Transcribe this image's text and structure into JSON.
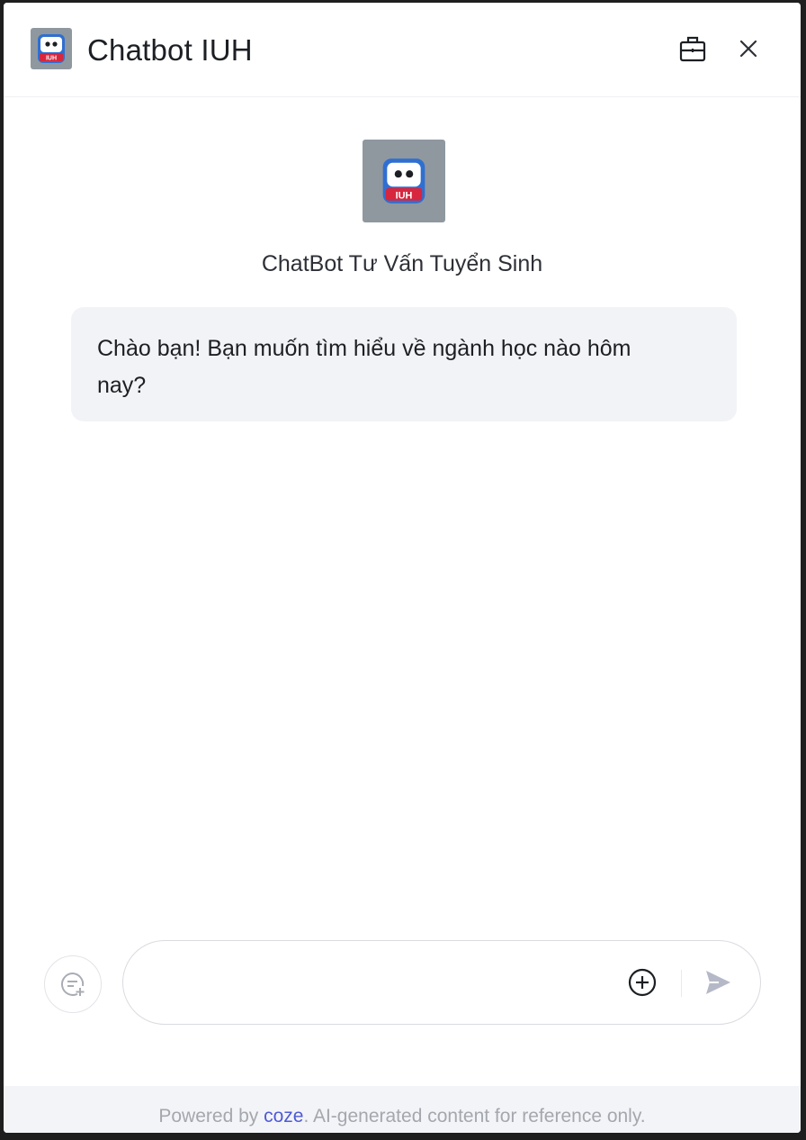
{
  "header": {
    "title": "Chatbot IUH",
    "logo_label": "IUH",
    "icons": [
      "briefcase-icon",
      "close-icon"
    ]
  },
  "bot": {
    "name": "ChatBot Tư Vấn Tuyển Sinh",
    "avatar_label": "IUH"
  },
  "messages": [
    {
      "role": "bot",
      "text": "Chào bạn! Bạn muốn tìm hiểu về ngành học nào hôm nay?"
    }
  ],
  "composer": {
    "value": "",
    "placeholder": "",
    "icons": [
      "new-chat-icon",
      "add-attachment-icon",
      "send-icon"
    ]
  },
  "footer": {
    "prefix": "Powered by ",
    "brand": "coze",
    "suffix": ". AI-generated content for reference only."
  },
  "colors": {
    "accent": "#4e5bd6",
    "bubble_bg": "#f2f3f7",
    "avatar_bg": "#8f989f",
    "logo_blue": "#2f6fd1",
    "logo_red": "#d7263d"
  }
}
